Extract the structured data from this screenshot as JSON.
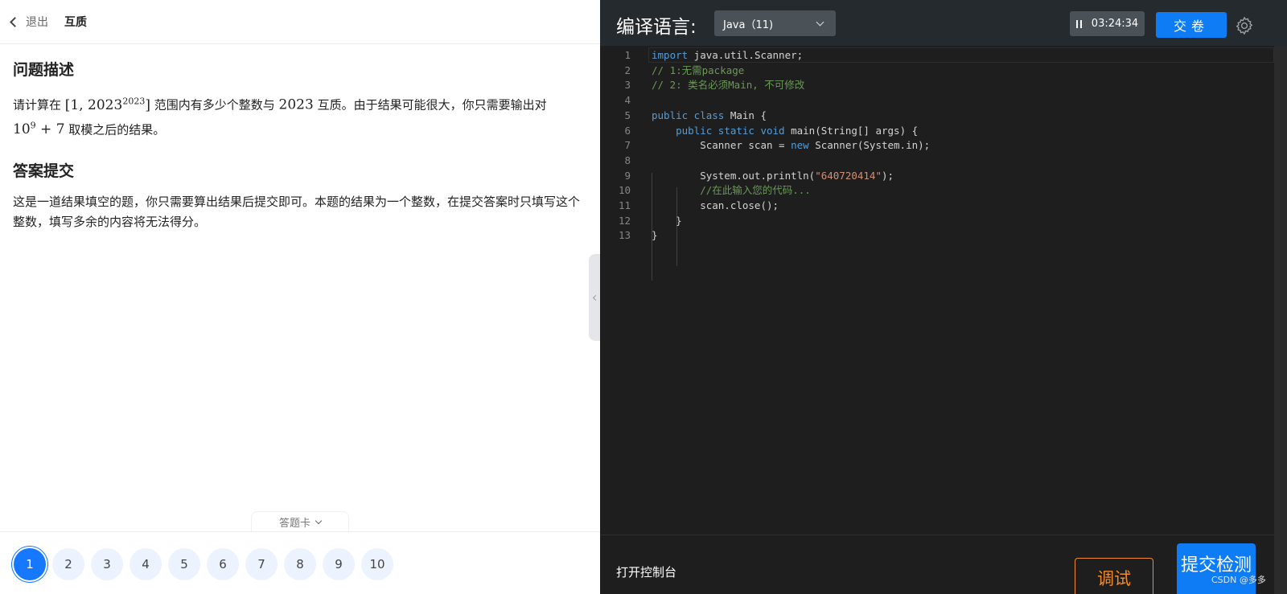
{
  "header": {
    "back_label": "退出",
    "question_title": "互质"
  },
  "problem": {
    "desc_heading": "问题描述",
    "desc_pre": "请计算在",
    "desc_range_open": "[1, 2023",
    "desc_range_exp": "2023",
    "desc_range_close": "]",
    "desc_mid": "范围内有多少个整数与",
    "desc_num": "2023",
    "desc_post": "互质。由于结果可能很大，你只需要输出对",
    "desc_mod_base": "10",
    "desc_mod_exp": "9",
    "desc_mod_rest": " + 7",
    "desc_tail": "取模之后的结果。",
    "answer_heading": "答案提交",
    "answer_text": "这是一道结果填空的题，你只需要算出结果后提交即可。本题的结果为一个整数，在提交答案时只填写这个整数，填写多余的内容将无法得分。"
  },
  "answer_card": {
    "toggle_label": "答题卡",
    "numbers": [
      "1",
      "2",
      "3",
      "4",
      "5",
      "6",
      "7",
      "8",
      "9",
      "10"
    ],
    "active": "1"
  },
  "editor_header": {
    "lang_label": "编译语言:",
    "lang_value": "Java（11)",
    "timer": "03:24:34",
    "submit_label": "交卷"
  },
  "code_lines": [
    {
      "n": "1",
      "tokens": [
        {
          "t": "import",
          "c": "kw"
        },
        {
          "t": " java.util.Scanner;",
          "c": ""
        }
      ]
    },
    {
      "n": "2",
      "tokens": [
        {
          "t": "// 1:无需package",
          "c": "cm"
        }
      ]
    },
    {
      "n": "3",
      "tokens": [
        {
          "t": "// 2: 类名必须Main, 不可修改",
          "c": "cm"
        }
      ]
    },
    {
      "n": "4",
      "tokens": []
    },
    {
      "n": "5",
      "tokens": [
        {
          "t": "public class",
          "c": "kw"
        },
        {
          "t": " Main {",
          "c": ""
        }
      ]
    },
    {
      "n": "6",
      "tokens": [
        {
          "t": "    ",
          "c": ""
        },
        {
          "t": "public static void",
          "c": "kw"
        },
        {
          "t": " main(String[] args) {",
          "c": ""
        }
      ]
    },
    {
      "n": "7",
      "tokens": [
        {
          "t": "        Scanner scan = ",
          "c": ""
        },
        {
          "t": "new",
          "c": "kw"
        },
        {
          "t": " Scanner(System.in);",
          "c": ""
        }
      ]
    },
    {
      "n": "8",
      "tokens": []
    },
    {
      "n": "9",
      "tokens": [
        {
          "t": "        System.out.println(",
          "c": ""
        },
        {
          "t": "\"640720414\"",
          "c": "st"
        },
        {
          "t": ");",
          "c": ""
        }
      ]
    },
    {
      "n": "10",
      "tokens": [
        {
          "t": "        ",
          "c": ""
        },
        {
          "t": "//在此输入您的代码...",
          "c": "cm"
        }
      ]
    },
    {
      "n": "11",
      "tokens": [
        {
          "t": "        scan.close();",
          "c": ""
        }
      ]
    },
    {
      "n": "12",
      "tokens": [
        {
          "t": "    }",
          "c": ""
        }
      ]
    },
    {
      "n": "13",
      "tokens": [
        {
          "t": "}",
          "c": ""
        }
      ]
    }
  ],
  "bottom": {
    "console_label": "打开控制台",
    "debug_label": "调试",
    "check_label": "提交检测"
  },
  "watermark": "CSDN @多多",
  "colors": {
    "primary": "#0d7cf5",
    "debug": "#f08c2e",
    "editor_bg": "#1e1e1e"
  }
}
